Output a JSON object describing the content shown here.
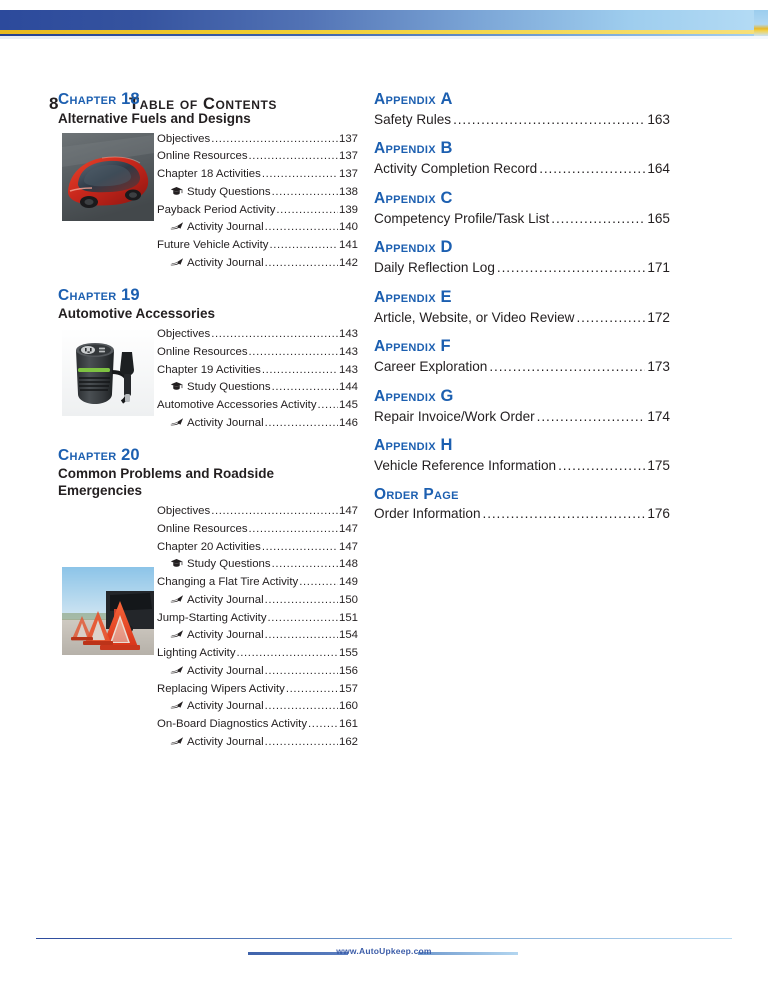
{
  "header": {
    "page_number": "8",
    "running_title": "Table of Contents"
  },
  "colors": {
    "accent_blue": "#1c5fb0",
    "band_dark": "#2c4a9c",
    "band_light": "#b5dcf5",
    "gold": "#e8b820",
    "text": "#231f20",
    "footer_blue": "#3b5ca8"
  },
  "left_column": {
    "chapters": [
      {
        "label": "Chapter",
        "number": "18",
        "title": "Alternative Fuels and Designs",
        "thumb_alt": "red-concept-car",
        "entries": [
          {
            "icon": "",
            "text": "Objectives",
            "page": "137",
            "indent": false
          },
          {
            "icon": "",
            "text": "Online Resources",
            "page": "137",
            "indent": false
          },
          {
            "icon": "",
            "text": "Chapter 18 Activities",
            "page": "137",
            "indent": false
          },
          {
            "icon": "graduation-cap",
            "text": "Study Questions",
            "page": "138",
            "indent": true
          },
          {
            "icon": "",
            "text": "Payback Period Activity",
            "page": "139",
            "indent": false
          },
          {
            "icon": "pen",
            "text": "Activity Journal",
            "page": "140",
            "indent": true
          },
          {
            "icon": "",
            "text": "Future Vehicle Activity",
            "page": "141",
            "indent": false
          },
          {
            "icon": "pen",
            "text": "Activity Journal",
            "page": "142",
            "indent": true
          }
        ]
      },
      {
        "label": "Chapter",
        "number": "19",
        "title": "Automotive Accessories",
        "thumb_alt": "power-inverter",
        "entries": [
          {
            "icon": "",
            "text": "Objectives",
            "page": "143",
            "indent": false
          },
          {
            "icon": "",
            "text": "Online Resources",
            "page": "143",
            "indent": false
          },
          {
            "icon": "",
            "text": "Chapter 19 Activities",
            "page": "143",
            "indent": false
          },
          {
            "icon": "graduation-cap",
            "text": "Study Questions",
            "page": "144",
            "indent": true
          },
          {
            "icon": "",
            "text": "Automotive Accessories Activity",
            "page": "145",
            "indent": false
          },
          {
            "icon": "pen",
            "text": "Activity Journal",
            "page": "146",
            "indent": true
          }
        ]
      },
      {
        "label": "Chapter",
        "number": "20",
        "title": "Common Problems and Roadside Emergencies",
        "thumb_alt": "roadside-warning-triangles",
        "entries": [
          {
            "icon": "",
            "text": "Objectives",
            "page": "147",
            "indent": false
          },
          {
            "icon": "",
            "text": "Online Resources",
            "page": "147",
            "indent": false
          },
          {
            "icon": "",
            "text": "Chapter 20 Activities",
            "page": "147",
            "indent": false
          },
          {
            "icon": "graduation-cap",
            "text": "Study Questions",
            "page": "148",
            "indent": true
          },
          {
            "icon": "",
            "text": "Changing a Flat Tire Activity",
            "page": "149",
            "indent": false
          },
          {
            "icon": "pen",
            "text": "Activity Journal",
            "page": "150",
            "indent": true
          },
          {
            "icon": "",
            "text": "Jump-Starting Activity",
            "page": "151",
            "indent": false
          },
          {
            "icon": "pen",
            "text": "Activity Journal",
            "page": "154",
            "indent": true
          },
          {
            "icon": "",
            "text": "Lighting Activity",
            "page": "155",
            "indent": false
          },
          {
            "icon": "pen",
            "text": "Activity Journal",
            "page": "156",
            "indent": true
          },
          {
            "icon": "",
            "text": "Replacing Wipers Activity",
            "page": "157",
            "indent": false
          },
          {
            "icon": "pen",
            "text": "Activity Journal",
            "page": "160",
            "indent": true
          },
          {
            "icon": "",
            "text": "On-Board Diagnostics Activity",
            "page": "161",
            "indent": false
          },
          {
            "icon": "pen",
            "text": "Activity Journal",
            "page": "162",
            "indent": true
          }
        ]
      }
    ]
  },
  "right_column": {
    "appendices": [
      {
        "label": "Appendix",
        "letter": "A",
        "title": "Safety Rules",
        "page": "163"
      },
      {
        "label": "Appendix",
        "letter": "B",
        "title": "Activity Completion Record",
        "page": "164"
      },
      {
        "label": "Appendix",
        "letter": "C",
        "title": "Competency Profile/Task List",
        "page": "165"
      },
      {
        "label": "Appendix",
        "letter": "D",
        "title": "Daily Reflection Log",
        "page": "171"
      },
      {
        "label": "Appendix",
        "letter": "E",
        "title": "Article, Website, or Video Review",
        "page": "172"
      },
      {
        "label": "Appendix",
        "letter": "F",
        "title": "Career Exploration",
        "page": "173"
      },
      {
        "label": "Appendix",
        "letter": "G",
        "title": "Repair Invoice/Work Order",
        "page": "174"
      },
      {
        "label": "Appendix",
        "letter": "H",
        "title": "Vehicle Reference Information",
        "page": "175"
      },
      {
        "label": "Order Page",
        "letter": "",
        "title": "Order Information",
        "page": "176"
      }
    ]
  },
  "footer": {
    "website": "www.AutoUpkeep.com"
  }
}
